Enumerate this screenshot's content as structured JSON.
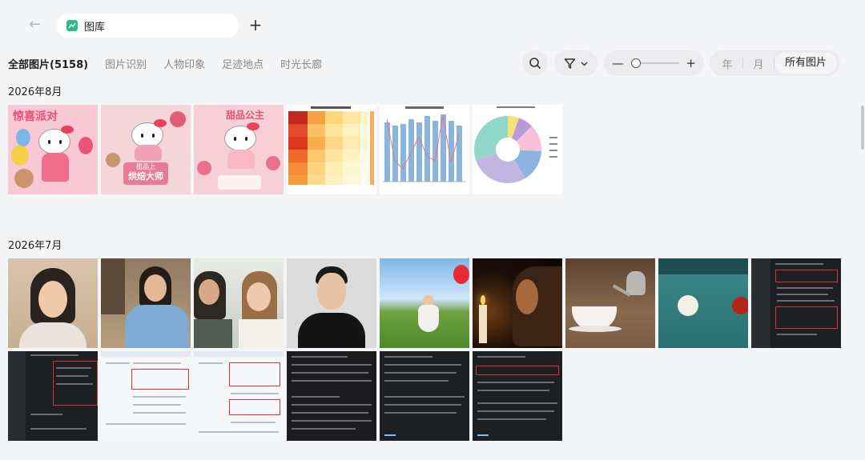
{
  "header": {
    "tab_title": "图库",
    "back_icon": "arrow-left-icon",
    "add_tab_icon": "plus-icon"
  },
  "subtabs": [
    {
      "label": "全部图片(5158)",
      "active": true
    },
    {
      "label": "图片识别",
      "active": false
    },
    {
      "label": "人物印象",
      "active": false
    },
    {
      "label": "足迹地点",
      "active": false
    },
    {
      "label": "时光长廊",
      "active": false
    }
  ],
  "toolbar": {
    "search_icon": "search-icon",
    "filter_icon": "filter-icon",
    "zoom_level": 0.0,
    "view_options": [
      "年",
      "月",
      "所有图片"
    ],
    "view_selected": "所有图片"
  },
  "sections": [
    {
      "title": "2026年8月",
      "count": 6
    },
    {
      "title": "2026年7月",
      "count": 15
    }
  ],
  "thumb_text": {
    "kitty1": "惊喜派对",
    "kitty2_line1": "甜品上",
    "kitty2_line2": "烘焙大师",
    "kitty3": "甜品公主"
  },
  "colors": {
    "accent": "#2fb88a",
    "background": "#f4f5f7"
  }
}
